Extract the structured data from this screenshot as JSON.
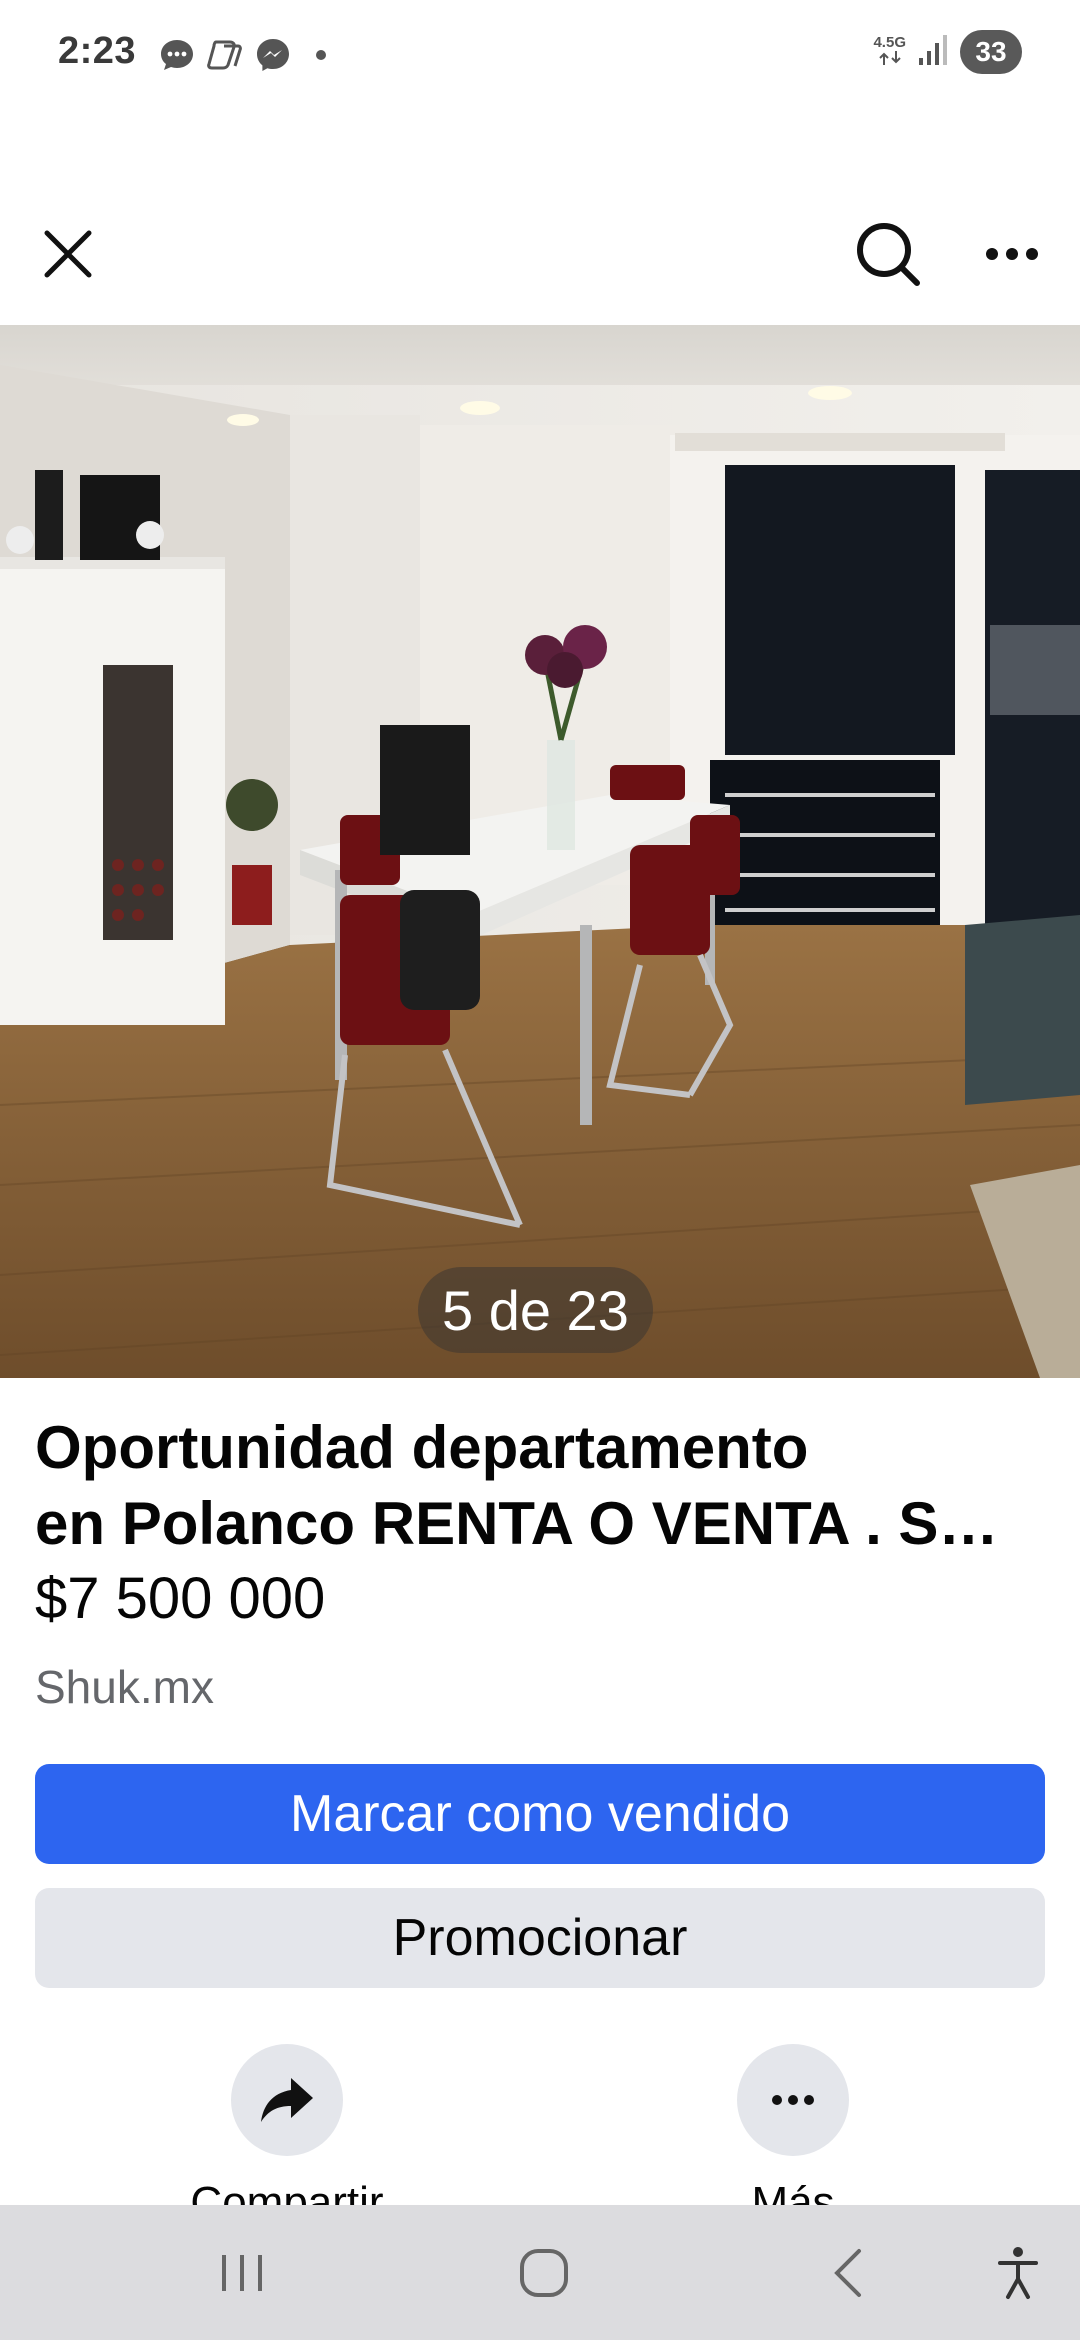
{
  "status_bar": {
    "time": "2:23",
    "network": "4.5G",
    "battery": "33",
    "notification_icons": [
      "messages-icon",
      "copilot-icon",
      "messenger-icon"
    ]
  },
  "top_bar": {
    "icons": [
      "close-icon",
      "search-icon",
      "more-options-icon"
    ]
  },
  "photo": {
    "counter": "5 de 23",
    "description_icon": "listing-photo"
  },
  "listing": {
    "title_line1": "Oportunidad departamento",
    "title_line2": "en Polanco RENTA O VENTA . S…",
    "price": "$7 500 000",
    "source": "Shuk.mx"
  },
  "buttons": {
    "mark_sold": "Marcar como vendido",
    "promote": "Promocionar"
  },
  "actions": {
    "share_label": "Compartir",
    "more_label": "Más"
  },
  "colors": {
    "primary_button": "#2d65f0",
    "secondary_button": "#e4e6eb",
    "secondary_text": "#65676b",
    "nav_bar": "#dcdcdf"
  }
}
